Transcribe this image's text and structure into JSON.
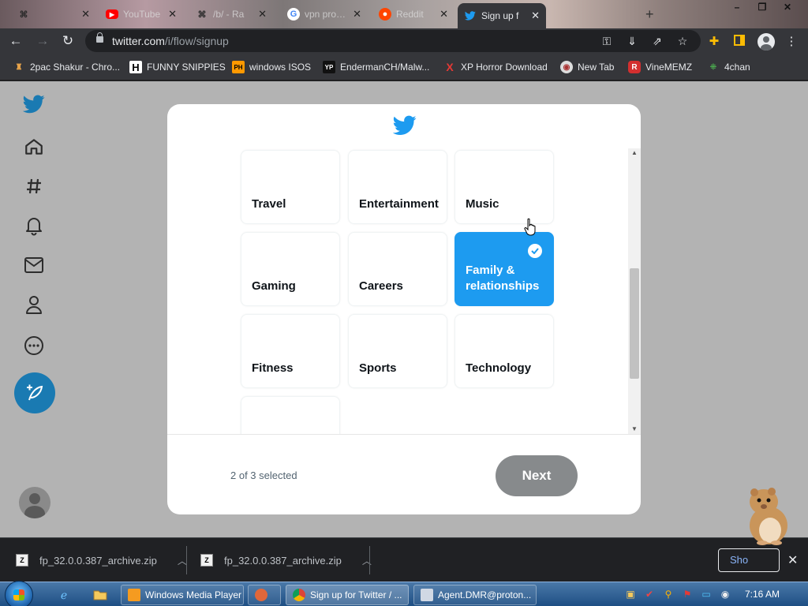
{
  "browser": {
    "tabs": [
      {
        "label": "",
        "favicon": "grid-icon"
      },
      {
        "label": "YouTube",
        "favicon": "youtube-icon"
      },
      {
        "label": "/b/ - Ra",
        "favicon": "grid-icon"
      },
      {
        "label": "vpn proton",
        "favicon": "google-icon"
      },
      {
        "label": "Reddit",
        "favicon": "reddit-icon"
      },
      {
        "label": "Sign up f",
        "favicon": "twitter-icon",
        "active": true
      }
    ],
    "url_domain": "twitter.com",
    "url_path": "/i/flow/signup",
    "bookmarks": [
      {
        "label": "2pac Shakur - Chro...",
        "icon": "bookmark-icon"
      },
      {
        "label": "FUNNY SNIPPIES",
        "icon": "H"
      },
      {
        "label": "windows ISOS",
        "icon": "PH"
      },
      {
        "label": "EndermanCH/Malw...",
        "icon": "YP"
      },
      {
        "label": "XP Horror Download",
        "icon": "X"
      },
      {
        "label": "New Tab",
        "icon": "globe-icon"
      },
      {
        "label": "VineMEMZ",
        "icon": "R"
      },
      {
        "label": "4chan",
        "icon": "clover-icon"
      }
    ]
  },
  "modal": {
    "topics": [
      {
        "label": "Travel",
        "selected": false
      },
      {
        "label": "Entertainment",
        "selected": false
      },
      {
        "label": "Music",
        "selected": false
      },
      {
        "label": "Gaming",
        "selected": false
      },
      {
        "label": "Careers",
        "selected": false
      },
      {
        "label": "Family & relationships",
        "selected": true
      },
      {
        "label": "Fitness",
        "selected": false
      },
      {
        "label": "Sports",
        "selected": false
      },
      {
        "label": "Technology",
        "selected": false
      },
      {
        "label": "",
        "selected": false
      }
    ],
    "selection_count": "2 of 3 selected",
    "next_label": "Next"
  },
  "downloads": {
    "items": [
      {
        "filename": "fp_32.0.0.387_archive.zip"
      },
      {
        "filename": "fp_32.0.0.387_archive.zip"
      }
    ],
    "show_all_label": "Sho"
  },
  "taskbar": {
    "buttons": [
      {
        "label": "Windows Media Player"
      },
      {
        "label": ""
      },
      {
        "label": "Sign up for Twitter / ..."
      },
      {
        "label": "Agent.DMR@proton..."
      }
    ],
    "clock": "7:16 AM"
  },
  "colors": {
    "twitter_blue": "#1d9bf0",
    "overlay_gray": "#b3b3b3",
    "next_disabled": "#878a8c"
  }
}
